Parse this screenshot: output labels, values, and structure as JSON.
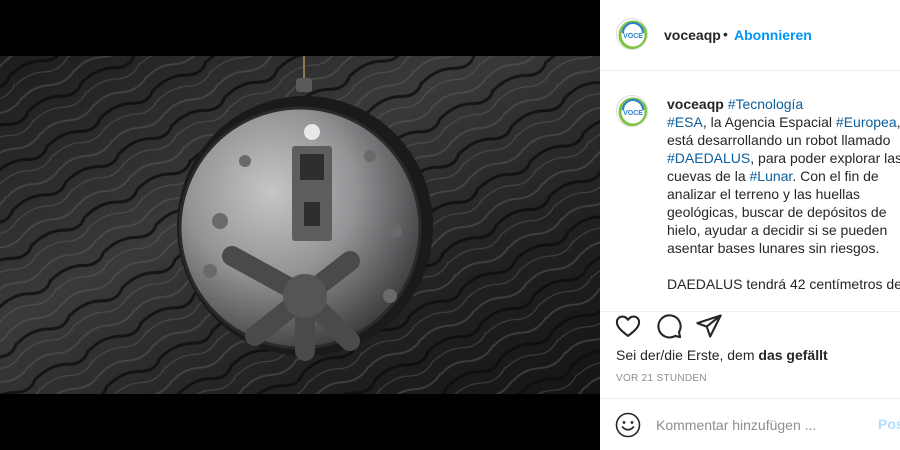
{
  "media": {
    "description_icon": "robot-sphere-image"
  },
  "header": {
    "username": "voceaqp",
    "separator": "•",
    "follow_label": "Abonnieren",
    "avatar_text": "VOCE"
  },
  "caption": {
    "username": "voceaqp",
    "lines": [
      {
        "parts": [
          [
            "h",
            "#Tecnología"
          ]
        ]
      },
      {
        "parts": [
          [
            "h",
            "#ESA"
          ],
          [
            "t",
            ", la Agencia Espacial "
          ],
          [
            "h",
            "#Europea"
          ],
          [
            "t",
            ","
          ]
        ]
      },
      {
        "parts": [
          [
            "t",
            "está desarrollando un robot llamado"
          ]
        ]
      },
      {
        "parts": [
          [
            "h",
            "#DAEDALUS"
          ],
          [
            "t",
            ", para poder explorar las"
          ]
        ]
      },
      {
        "parts": [
          [
            "t",
            "cuevas de la "
          ],
          [
            "h",
            "#Lunar"
          ],
          [
            "t",
            ". Con el fin de"
          ]
        ]
      },
      {
        "parts": [
          [
            "t",
            "analizar el terreno y las huellas"
          ]
        ]
      },
      {
        "parts": [
          [
            "t",
            "geológicas, buscar de depósitos de"
          ]
        ]
      },
      {
        "parts": [
          [
            "t",
            "hielo, ayudar a decidir si se pueden"
          ]
        ]
      },
      {
        "parts": [
          [
            "t",
            "asentar bases lunares sin riesgos."
          ]
        ]
      },
      {
        "parts": []
      },
      {
        "parts": [
          [
            "t",
            "DAEDALUS tendrá 42 centímetros de"
          ]
        ]
      }
    ]
  },
  "actions": {
    "like_icon": "heart-icon",
    "comment_icon": "comment-icon",
    "share_icon": "share-icon"
  },
  "likes": {
    "prefix": "Sei der/die Erste, dem ",
    "bold": "das gefällt"
  },
  "timestamp": "VOR 21 STUNDEN",
  "comment": {
    "placeholder": "Kommentar hinzufügen ...",
    "post_label": "Posten"
  },
  "colors": {
    "link": "#0095f6",
    "hashtag": "#0b5d9c",
    "text": "#262626",
    "muted": "#8e8e8e"
  }
}
